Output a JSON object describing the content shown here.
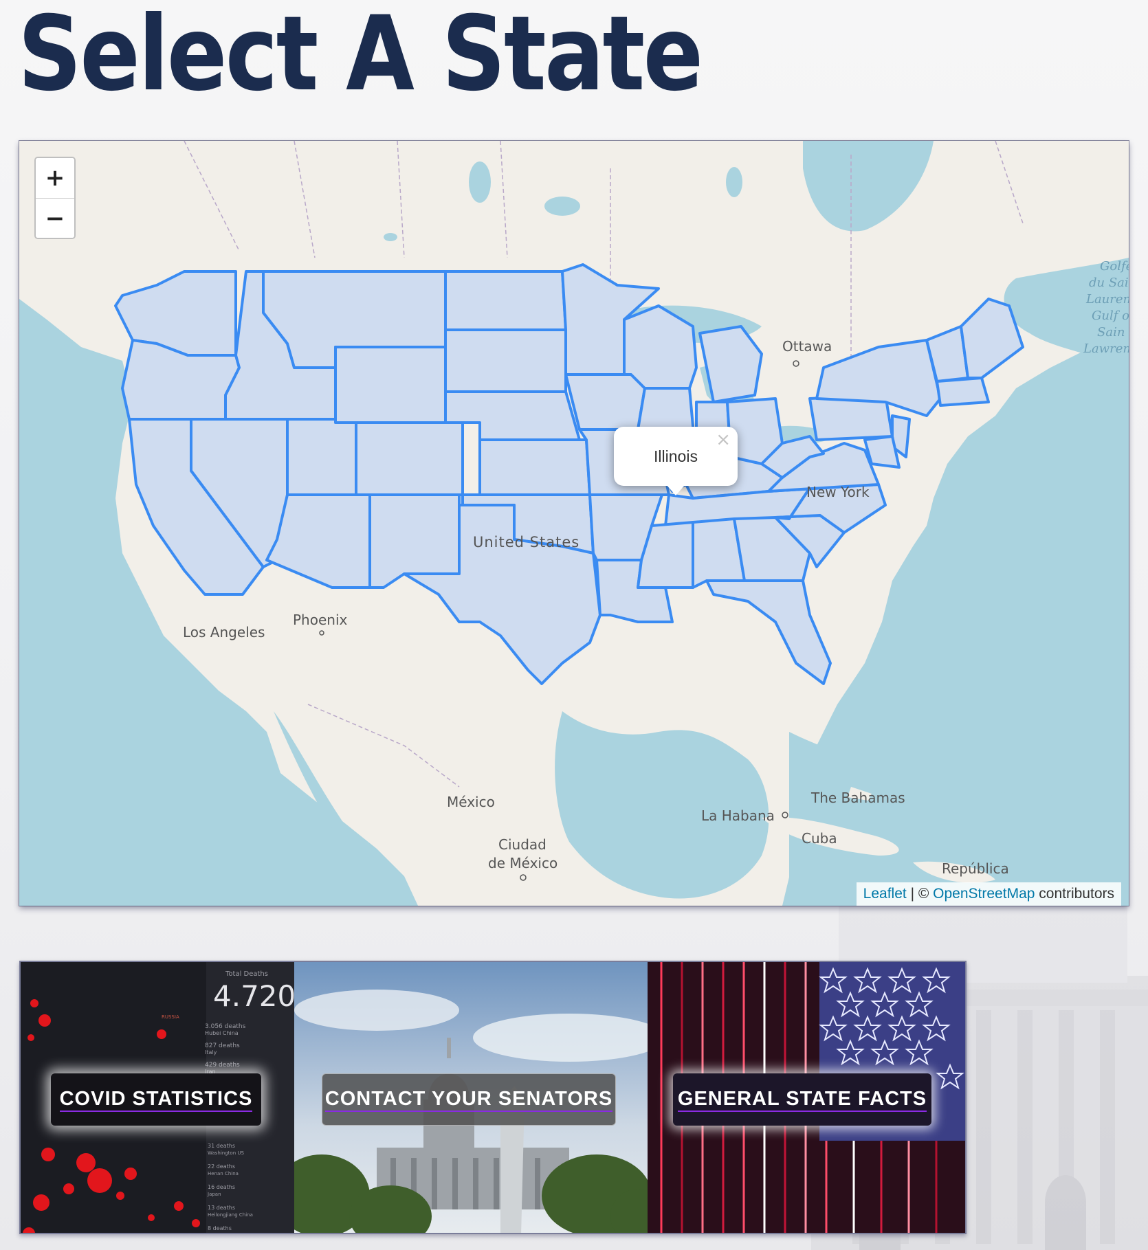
{
  "page": {
    "title": "Select A State"
  },
  "map": {
    "zoom_in_label": "+",
    "zoom_out_label": "−",
    "popup": {
      "state": "Illinois",
      "close_label": "×"
    },
    "place_labels": {
      "ottawa": "Ottawa",
      "new_york": "New York",
      "united_states": "United States",
      "phoenix": "Phoenix",
      "los_angeles": "Los Angeles",
      "mexico": "México",
      "ciudad_1": "Ciudad",
      "ciudad_2": "de México",
      "la_habana": "La Habana",
      "cuba": "Cuba",
      "bahamas": "The Bahamas",
      "republica": "República",
      "golfe_1": "Golfe",
      "golfe_2": "du Sai",
      "golfe_3": "Lauren",
      "golfe_4": "Gulf o",
      "golfe_5": "Sain",
      "golfe_6": "Lawren"
    },
    "attribution": {
      "leaflet": "Leaflet",
      "separator": " | © ",
      "osm": "OpenStreetMap",
      "suffix": " contributors"
    },
    "colors": {
      "water": "#aad3df",
      "land": "#f2efe9",
      "state_fill": "#cfdcf0",
      "state_stroke": "#3a8bf2"
    }
  },
  "cards": [
    {
      "label": "COVID STATISTICS",
      "image": "covid-dashboard-map"
    },
    {
      "label": "CONTACT YOUR SENATORS",
      "image": "us-capitol-building"
    },
    {
      "label": "GENERAL STATE FACTS",
      "image": "american-flag-stars"
    }
  ],
  "covid_card": {
    "heading": "Total Deaths",
    "total": "4.720",
    "region_label": "RUSSIA",
    "rows": [
      [
        "3.056 deaths",
        "Hubei China"
      ],
      [
        "827 deaths",
        "Italy"
      ],
      [
        "429 deaths",
        "Iran"
      ],
      [
        "31 deaths",
        "Washington US"
      ],
      [
        "22 deaths",
        "Henan China"
      ],
      [
        "16 deaths",
        "Japan"
      ],
      [
        "13 deaths",
        "Heilongjiang China"
      ],
      [
        "8 deaths",
        ""
      ]
    ]
  }
}
